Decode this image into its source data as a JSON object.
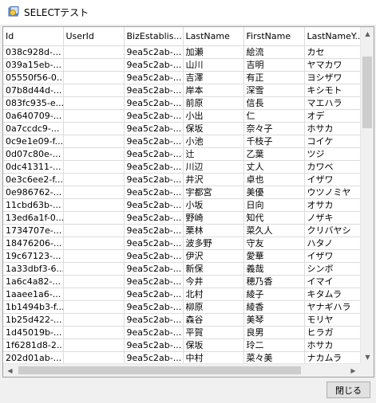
{
  "window": {
    "title": "SELECTテスト",
    "icon": "app-icon"
  },
  "table": {
    "columns": [
      "Id",
      "UserId",
      "BizEstablis...",
      "LastName",
      "FirstName",
      "LastNameY..."
    ],
    "rows": [
      [
        "038c928d-...",
        "",
        "9ea5c2ab-...",
        "加瀬",
        "絵流",
        "カセ"
      ],
      [
        "039a15eb-...",
        "",
        "9ea5c2ab-...",
        "山川",
        "吉明",
        "ヤマカワ"
      ],
      [
        "05550f56-0...",
        "",
        "9ea5c2ab-...",
        "吉澤",
        "有正",
        "ヨシザワ"
      ],
      [
        "07b8d44d-...",
        "",
        "9ea5c2ab-...",
        "岸本",
        "深雪",
        "キシモト"
      ],
      [
        "083fc935-e...",
        "",
        "9ea5c2ab-...",
        "前原",
        "信長",
        "マエハラ"
      ],
      [
        "0a640709-...",
        "",
        "9ea5c2ab-...",
        "小出",
        "仁",
        "オデ"
      ],
      [
        "0a7ccdc9-...",
        "",
        "9ea5c2ab-...",
        "保坂",
        "奈々子",
        "ホサカ"
      ],
      [
        "0c9e1e09-f...",
        "",
        "9ea5c2ab-...",
        "小池",
        "千枝子",
        "コイケ"
      ],
      [
        "0d07c80e-...",
        "",
        "9ea5c2ab-...",
        "辻",
        "乙葉",
        "ツジ"
      ],
      [
        "0dc41311-...",
        "",
        "9ea5c2ab-...",
        "川辺",
        "丈人",
        "カワベ"
      ],
      [
        "0e3c6ee2-f...",
        "",
        "9ea5c2ab-...",
        "井沢",
        "卓也",
        "イザワ"
      ],
      [
        "0e986762-...",
        "",
        "9ea5c2ab-...",
        "宇都宮",
        "美優",
        "ウツノミヤ"
      ],
      [
        "11cbd63b-...",
        "",
        "9ea5c2ab-...",
        "小坂",
        "日向",
        "オサカ"
      ],
      [
        "13ed6a1f-0...",
        "",
        "9ea5c2ab-...",
        "野崎",
        "知代",
        "ノザキ"
      ],
      [
        "1734707e-...",
        "",
        "9ea5c2ab-...",
        "栗林",
        "菜久人",
        "クリバヤシ"
      ],
      [
        "18476206-...",
        "",
        "9ea5c2ab-...",
        "波多野",
        "守友",
        "ハタノ"
      ],
      [
        "19c67123-...",
        "",
        "9ea5c2ab-...",
        "伊沢",
        "愛華",
        "イザワ"
      ],
      [
        "1a33dbf3-6...",
        "",
        "9ea5c2ab-...",
        "新保",
        "義哉",
        "シンボ"
      ],
      [
        "1a6c4a82-...",
        "",
        "9ea5c2ab-...",
        "今井",
        "穂乃香",
        "イマイ"
      ],
      [
        "1aaee1a6-...",
        "",
        "9ea5c2ab-...",
        "北村",
        "綾子",
        "キタムラ"
      ],
      [
        "1b1494b3-f...",
        "",
        "9ea5c2ab-...",
        "柳原",
        "綾香",
        "ヤナギハラ"
      ],
      [
        "1b25d422-...",
        "",
        "9ea5c2ab-...",
        "森谷",
        "美琴",
        "モリヤ"
      ],
      [
        "1d45019b-...",
        "",
        "9ea5c2ab-...",
        "平賀",
        "良男",
        "ヒラガ"
      ],
      [
        "1f6281d8-2...",
        "",
        "9ea5c2ab-...",
        "保坂",
        "玲二",
        "ホサカ"
      ],
      [
        "202d01ab-...",
        "",
        "9ea5c2ab-...",
        "中村",
        "菜々美",
        "ナカムラ"
      ]
    ]
  },
  "scrollbars": {
    "vertical": {
      "up_icon": "chevron-up-icon",
      "down_icon": "chevron-down-icon"
    },
    "horizontal": {
      "left_icon": "chevron-left-icon",
      "right_icon": "chevron-right-icon"
    }
  },
  "footer": {
    "close_label": "閉じる"
  }
}
